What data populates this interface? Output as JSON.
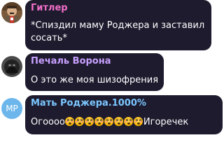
{
  "messages": [
    {
      "sender": "Гитлер",
      "sender_color": "#f06fc8",
      "lines": [
        "*Спиздил маму Роджера и заставил",
        "сосать*"
      ],
      "avatar": {
        "type": "photo",
        "icon": "hitler-portrait-icon"
      }
    },
    {
      "sender": "Печаль Ворона",
      "sender_color": "#c8a0ff",
      "lines": [
        "О это же моя шизофрения"
      ],
      "avatar": {
        "type": "photo",
        "icon": "raven-avatar-icon"
      }
    },
    {
      "sender": "Мать Роджера.1000%",
      "sender_color": "#7ac6ff",
      "line_prefix": "Огоооо",
      "emoji_count": 8,
      "emoji_icon": "flushed-face-emoji",
      "line_suffix": "Игоречек",
      "avatar": {
        "type": "initials",
        "initials": "МР",
        "color": "#6cb6ec"
      }
    }
  ]
}
